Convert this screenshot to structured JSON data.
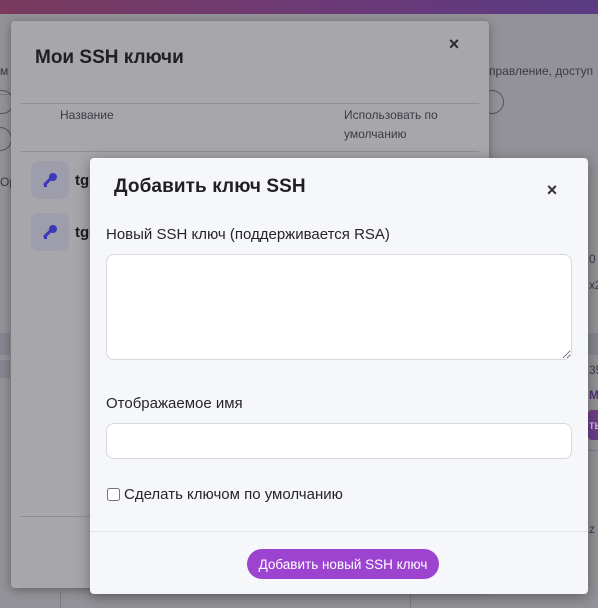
{
  "background": {
    "left_fragments": [
      "м",
      "Ор"
    ],
    "right_fragments": [
      "правление, доступ",
      "0 с",
      "x2",
      "35",
      "M",
      "ть",
      "z"
    ]
  },
  "keys_modal": {
    "title": "Мои SSH ключи",
    "close_symbol": "×",
    "columns": {
      "name": "Название",
      "default": "Использовать по умолчанию"
    },
    "rows": [
      {
        "name": "tg",
        "icon": "key-icon"
      },
      {
        "name": "tg",
        "icon": "key-icon"
      }
    ]
  },
  "add_modal": {
    "title": "Добавить ключ SSH",
    "close_symbol": "×",
    "key_label": "Новый SSH ключ (поддерживается RSA)",
    "key_value": "",
    "name_label": "Отображаемое имя",
    "name_value": "",
    "default_checkbox_label": "Сделать ключом по умолчанию",
    "default_checked": false,
    "submit_label": "Добавить новый SSH ключ"
  },
  "colors": {
    "accent": "#9c44cf",
    "key_icon": "#3a37b8"
  }
}
